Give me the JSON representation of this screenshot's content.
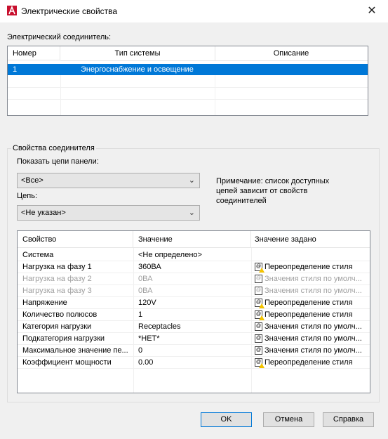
{
  "window": {
    "title": "Электрические свойства",
    "close_glyph": "✕",
    "icon": "autocad-a-icon"
  },
  "connector": {
    "label": "Электрический соединитель:",
    "columns": [
      "Номер",
      "Тип системы",
      "Описание"
    ],
    "rows": [
      {
        "number": "1",
        "system_type": "Энергоснабжение и освещение",
        "description": ""
      }
    ]
  },
  "props": {
    "group_label": "Свойства соединителя",
    "panel_label": "Показать цепи панели:",
    "panel_value": "<Все>",
    "circuit_label": "Цепь:",
    "circuit_value": "<Не указан>",
    "note": "Примечание: список доступных цепей зависит от свойств соединителей",
    "table": {
      "columns": [
        "Свойство",
        "Значение",
        "Значение задано"
      ],
      "rows": [
        {
          "property": "Система",
          "value": "<Не определено>",
          "source": "",
          "enabled": true,
          "icon": "",
          "warning": false
        },
        {
          "property": "Нагрузка на фазу 1",
          "value": "360ВА",
          "source": "Переопределение стиля",
          "enabled": true,
          "icon": "style-override-icon",
          "warning": true
        },
        {
          "property": "Нагрузка на фазу 2",
          "value": "0ВА",
          "source": "Значения стиля по умолч...",
          "enabled": false,
          "icon": "style-default-icon",
          "warning": false
        },
        {
          "property": "Нагрузка на фазу 3",
          "value": "0ВА",
          "source": "Значения стиля по умолч...",
          "enabled": false,
          "icon": "style-default-icon",
          "warning": false
        },
        {
          "property": "Напряжение",
          "value": "120V",
          "source": "Переопределение стиля",
          "enabled": true,
          "icon": "style-override-icon",
          "warning": true
        },
        {
          "property": "Количество полюсов",
          "value": "1",
          "source": "Переопределение стиля",
          "enabled": true,
          "icon": "style-override-icon",
          "warning": true
        },
        {
          "property": "Категория нагрузки",
          "value": "Receptacles",
          "source": "Значения стиля по умолч...",
          "enabled": true,
          "icon": "style-default-icon",
          "warning": false
        },
        {
          "property": "Подкатегория нагрузки",
          "value": "*НЕТ*",
          "source": "Значения стиля по умолч...",
          "enabled": true,
          "icon": "style-default-icon",
          "warning": false
        },
        {
          "property": "Максимальное значение пе...",
          "value": "0",
          "source": "Значения стиля по умолч...",
          "enabled": true,
          "icon": "style-default-icon",
          "warning": false
        },
        {
          "property": "Коэффициент мощности",
          "value": "0.00",
          "source": "Переопределение стиля",
          "enabled": true,
          "icon": "style-override-icon",
          "warning": true
        }
      ]
    }
  },
  "buttons": {
    "ok": "OK",
    "cancel": "Отмена",
    "help": "Справка"
  }
}
